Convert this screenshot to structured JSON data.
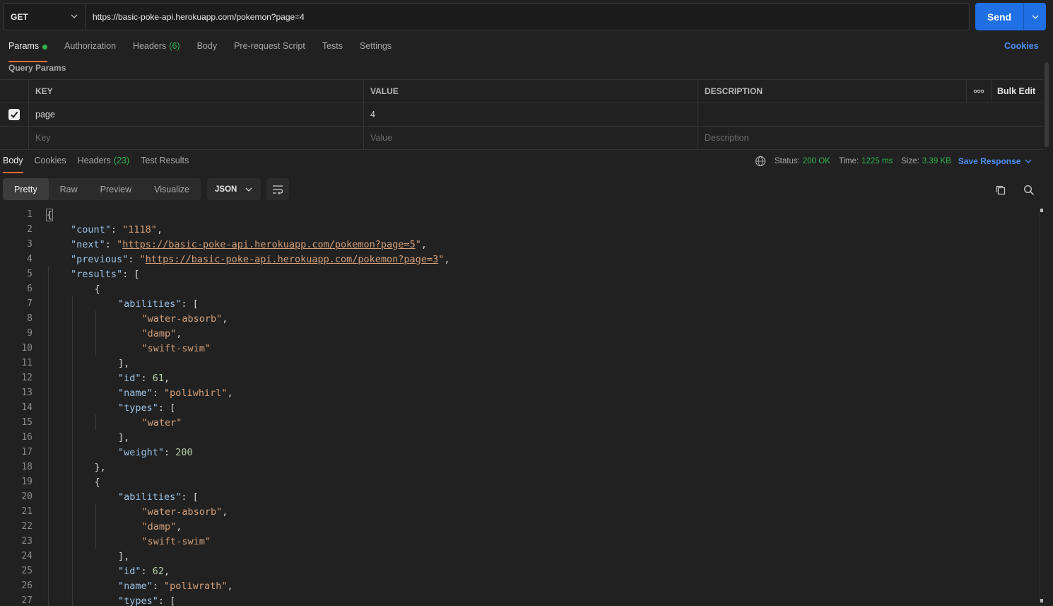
{
  "request": {
    "method": "GET",
    "url": "https://basic-poke-api.herokuapp.com/pokemon?page=4",
    "send_label": "Send"
  },
  "req_tabs": [
    {
      "label": "Params",
      "active": true
    },
    {
      "label": "Authorization"
    },
    {
      "label": "Headers",
      "count": "(6)"
    },
    {
      "label": "Body"
    },
    {
      "label": "Pre-request Script"
    },
    {
      "label": "Tests"
    },
    {
      "label": "Settings"
    }
  ],
  "cookies_link": "Cookies",
  "query_params": {
    "title": "Query Params",
    "headers": {
      "key": "KEY",
      "value": "VALUE",
      "description": "DESCRIPTION",
      "bulk_edit": "Bulk Edit"
    },
    "rows": [
      {
        "key": "page",
        "value": "4",
        "description": "",
        "checked": true
      }
    ],
    "placeholder": {
      "key": "Key",
      "value": "Value",
      "description": "Description"
    }
  },
  "resp_tabs": [
    {
      "label": "Body",
      "active": true
    },
    {
      "label": "Cookies"
    },
    {
      "label": "Headers",
      "count": "(23)"
    },
    {
      "label": "Test Results"
    }
  ],
  "status": {
    "status_label": "Status:",
    "status_value": "200 OK",
    "time_label": "Time:",
    "time_value": "1225 ms",
    "size_label": "Size:",
    "size_value": "3.39 KB",
    "save_response": "Save Response"
  },
  "view_modes": [
    "Pretty",
    "Raw",
    "Preview",
    "Visualize"
  ],
  "format": "JSON",
  "code_lines": [
    {
      "n": "1",
      "indent": 0,
      "html": "<span class='bracket-box'>{</span>"
    },
    {
      "n": "2",
      "indent": 1,
      "html": "<span class='k'>\"count\"</span>: <span class='s'>\"1118\"</span>,"
    },
    {
      "n": "3",
      "indent": 1,
      "html": "<span class='k'>\"next\"</span>: <span class='s'>\"</span><span class='u'>https://basic-poke-api.herokuapp.com/pokemon?page=5</span><span class='s'>\"</span>,"
    },
    {
      "n": "4",
      "indent": 1,
      "html": "<span class='k'>\"previous\"</span>: <span class='s'>\"</span><span class='u'>https://basic-poke-api.herokuapp.com/pokemon?page=3</span><span class='s'>\"</span>,"
    },
    {
      "n": "5",
      "indent": 1,
      "html": "<span class='k'>\"results\"</span>: ["
    },
    {
      "n": "6",
      "indent": 2,
      "html": "{"
    },
    {
      "n": "7",
      "indent": 3,
      "html": "<span class='k'>\"abilities\"</span>: ["
    },
    {
      "n": "8",
      "indent": 4,
      "html": "<span class='s'>\"water-absorb\"</span>,"
    },
    {
      "n": "9",
      "indent": 4,
      "html": "<span class='s'>\"damp\"</span>,"
    },
    {
      "n": "10",
      "indent": 4,
      "html": "<span class='s'>\"swift-swim\"</span>"
    },
    {
      "n": "11",
      "indent": 3,
      "html": "],"
    },
    {
      "n": "12",
      "indent": 3,
      "html": "<span class='k'>\"id\"</span>: <span class='n'>61</span>,"
    },
    {
      "n": "13",
      "indent": 3,
      "html": "<span class='k'>\"name\"</span>: <span class='s'>\"poliwhirl\"</span>,"
    },
    {
      "n": "14",
      "indent": 3,
      "html": "<span class='k'>\"types\"</span>: ["
    },
    {
      "n": "15",
      "indent": 4,
      "html": "<span class='s'>\"water\"</span>"
    },
    {
      "n": "16",
      "indent": 3,
      "html": "],"
    },
    {
      "n": "17",
      "indent": 3,
      "html": "<span class='k'>\"weight\"</span>: <span class='n'>200</span>"
    },
    {
      "n": "18",
      "indent": 2,
      "html": "},"
    },
    {
      "n": "19",
      "indent": 2,
      "html": "{"
    },
    {
      "n": "20",
      "indent": 3,
      "html": "<span class='k'>\"abilities\"</span>: ["
    },
    {
      "n": "21",
      "indent": 4,
      "html": "<span class='s'>\"water-absorb\"</span>,"
    },
    {
      "n": "22",
      "indent": 4,
      "html": "<span class='s'>\"damp\"</span>,"
    },
    {
      "n": "23",
      "indent": 4,
      "html": "<span class='s'>\"swift-swim\"</span>"
    },
    {
      "n": "24",
      "indent": 3,
      "html": "],"
    },
    {
      "n": "25",
      "indent": 3,
      "html": "<span class='k'>\"id\"</span>: <span class='n'>62</span>,"
    },
    {
      "n": "26",
      "indent": 3,
      "html": "<span class='k'>\"name\"</span>: <span class='s'>\"poliwrath\"</span>,"
    },
    {
      "n": "27",
      "indent": 3,
      "html": "<span class='k'>\"types\"</span>: ["
    }
  ],
  "colors": {
    "accent_blue": "#1f6fe5",
    "active_tab_underline": "#f26b3a",
    "status_green": "#2fb34f",
    "link_blue": "#4c8ff4"
  }
}
